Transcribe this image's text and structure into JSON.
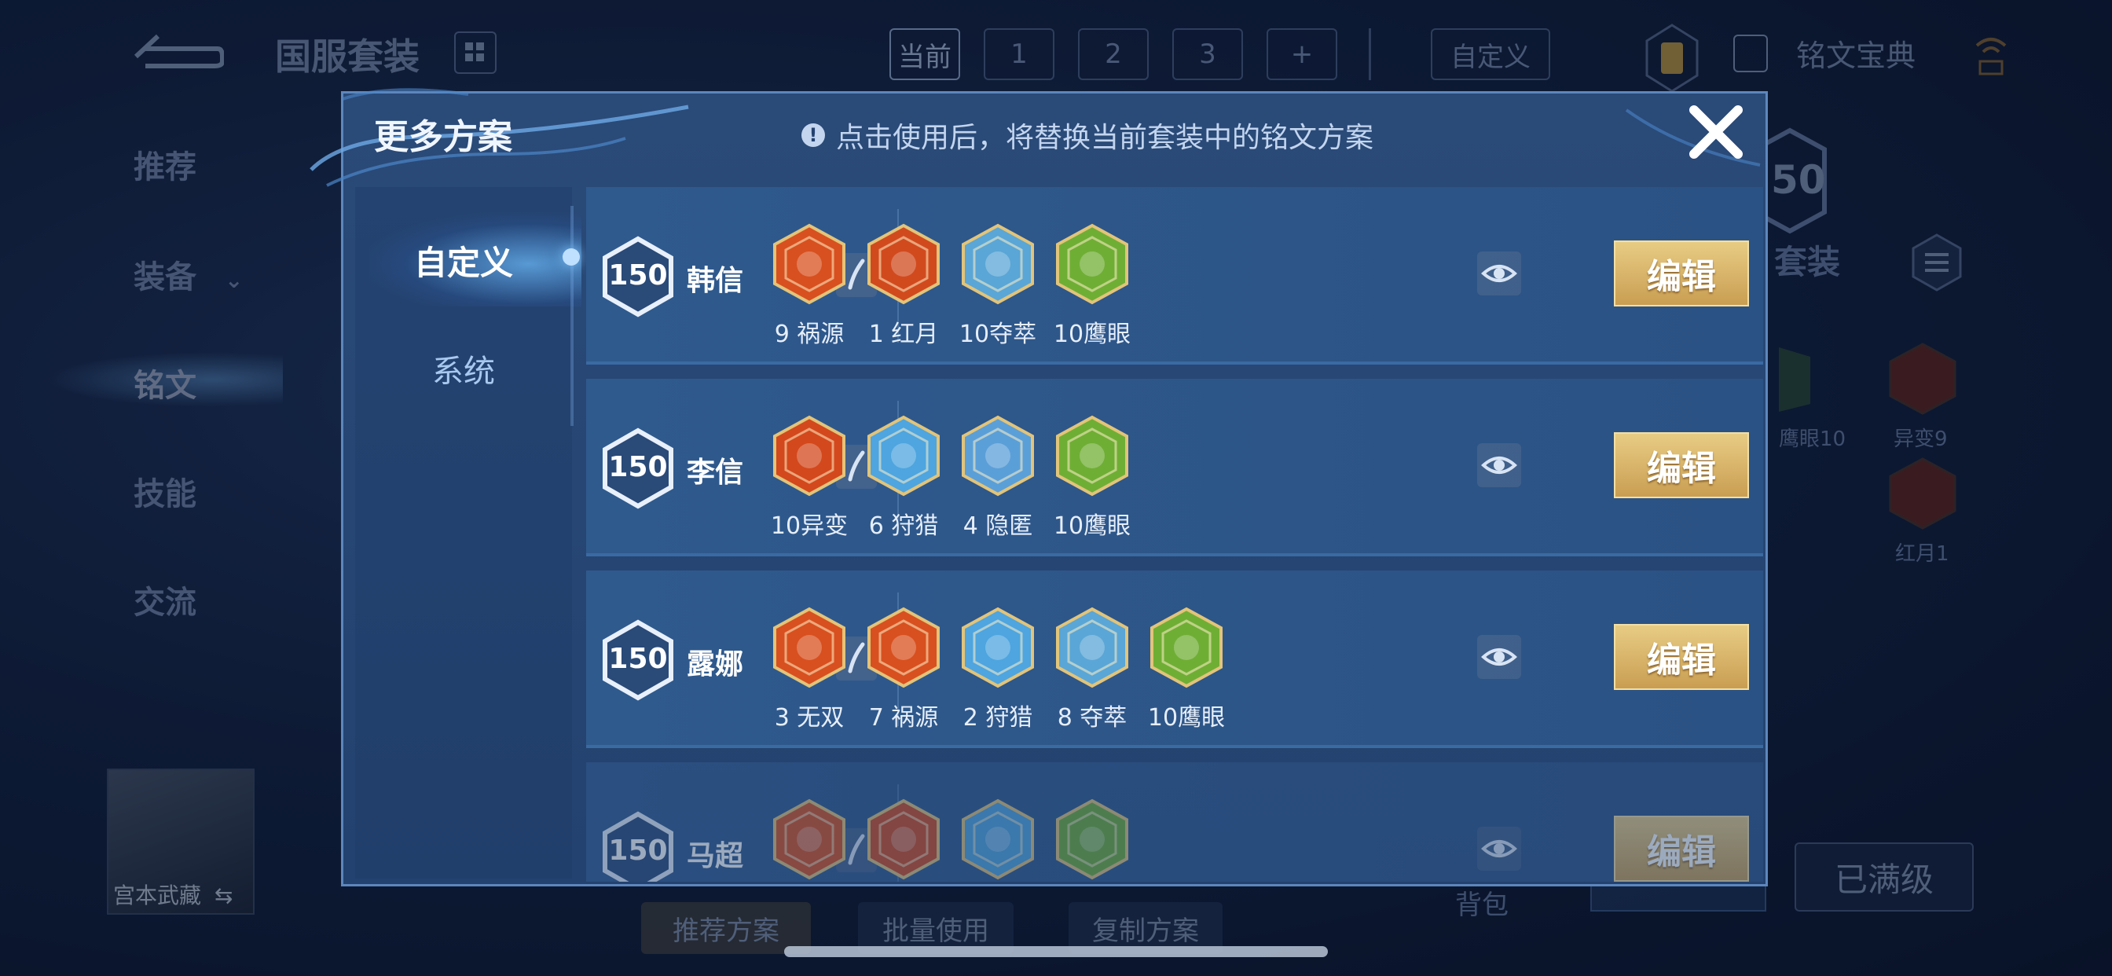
{
  "background": {
    "suit_title": "国服套装",
    "top_tabs": [
      "当前",
      "1",
      "2",
      "3",
      "+"
    ],
    "custom_tab": "自定义",
    "codex": "铭文宝典",
    "side_nav": [
      "推荐",
      "装备",
      "铭文",
      "技能",
      "交流"
    ],
    "hero_name": "宫本武藏",
    "level": "50",
    "suit_label": "套装",
    "rune_labels": [
      "鹰眼10",
      "异变9",
      "红月1"
    ],
    "max_level_button": "已满级",
    "bag_label": "背包",
    "bottom_buttons": [
      "推荐方案",
      "批量使用",
      "复制方案"
    ]
  },
  "modal": {
    "title": "更多方案",
    "notice": "点击使用后，将替换当前套装中的铭文方案",
    "notice_icon": "!",
    "close_icon": "close-icon",
    "tabs": [
      "自定义",
      "系统"
    ],
    "edit_label": "编辑"
  },
  "plans": [
    {
      "level": "150",
      "hero": "韩信",
      "runes": [
        {
          "label": "9 祸源",
          "color": "#d8501f"
        },
        {
          "label": "1 红月",
          "color": "#d14a1e"
        },
        {
          "label": "10夺萃",
          "color": "#5aa6d6"
        },
        {
          "label": "10鹰眼",
          "color": "#6fae35"
        }
      ]
    },
    {
      "level": "150",
      "hero": "李信",
      "runes": [
        {
          "label": "10异变",
          "color": "#d3481c"
        },
        {
          "label": "6 狩猎",
          "color": "#4ea5df"
        },
        {
          "label": "4 隐匿",
          "color": "#5b9fd8"
        },
        {
          "label": "10鹰眼",
          "color": "#6fae35"
        }
      ]
    },
    {
      "level": "150",
      "hero": "露娜",
      "runes": [
        {
          "label": "3 无双",
          "color": "#d8501f"
        },
        {
          "label": "7 祸源",
          "color": "#d8501f"
        },
        {
          "label": "2 狩猎",
          "color": "#4ea5df"
        },
        {
          "label": "8 夺萃",
          "color": "#5aa6d6"
        },
        {
          "label": "10鹰眼",
          "color": "#6fae35"
        }
      ]
    },
    {
      "level": "150",
      "hero": "马超",
      "runes": [
        {
          "label": "",
          "color": "#d8501f"
        },
        {
          "label": "",
          "color": "#d14a1e"
        },
        {
          "label": "",
          "color": "#4ea5df"
        },
        {
          "label": "",
          "color": "#6fae35"
        }
      ]
    }
  ]
}
